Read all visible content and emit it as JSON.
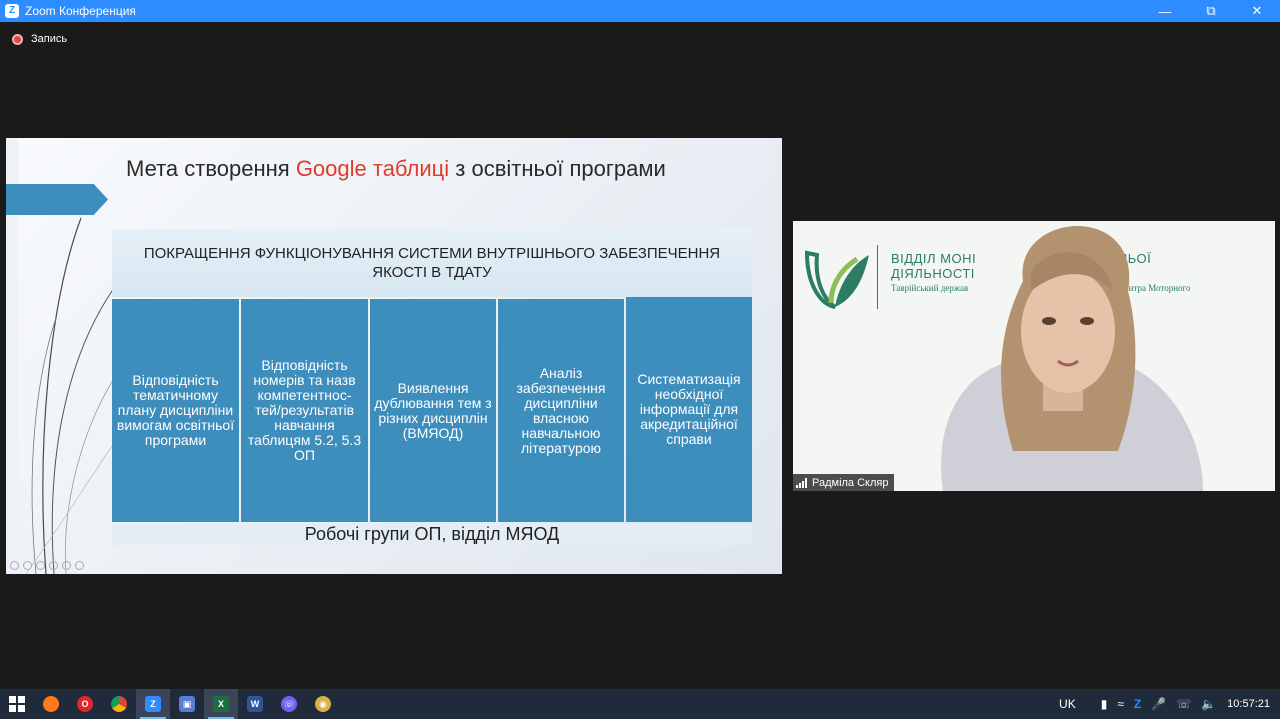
{
  "window": {
    "app_icon": "zoom-logo-icon",
    "title": "Zoom Конференция",
    "controls": [
      "minimize-icon",
      "restore-icon",
      "close-icon"
    ]
  },
  "recording": {
    "label": "Запись"
  },
  "slide": {
    "title_before": "Мета створення ",
    "title_accent": "Google таблиці",
    "title_after": " з освітньої програми",
    "header": "ПОКРАЩЕННЯ ФУНКЦІОНУВАННЯ СИСТЕМИ ВНУТРІШНЬОГО ЗАБЕЗПЕЧЕННЯ ЯКОСТІ В ТДАТУ",
    "columns": [
      "Відповідність тематичному плану дисципліни вимогам освітньої програми",
      "Відповідність номерів та назв компетентнос-тей/результатів навчання таблицям 5.2, 5.3 ОП",
      "Виявлення дублювання тем з різних дисциплін (ВМЯОД)",
      "Аналіз забезпечення дисципліни власною навчальною літературою",
      "Систематизація необхідної інформації для акредитаційної справи"
    ],
    "footer": "Робочі групи ОП, відділ МЯОД",
    "accent_color": "#e23a2c",
    "box_color": "#3d8dbd"
  },
  "video": {
    "logo_title_line1": "ВІДДІЛ МОНІ",
    "logo_title_line1b": "ВІТНЬОЇ",
    "logo_title_line2": "ДІЯЛЬНОСТІ",
    "logo_sub_a": "Таврійський держав",
    "logo_sub_b": "ені Дмитра Моторного",
    "participant_name": "Радміла Скляр"
  },
  "taskbar": {
    "apps": [
      {
        "name": "windows-start-icon",
        "color": "#ffffff"
      },
      {
        "name": "firefox-icon",
        "color": "#ff7a1a"
      },
      {
        "name": "opera-icon",
        "color": "#e0262d"
      },
      {
        "name": "chrome-icon",
        "color": "#4caf50"
      },
      {
        "name": "zoom-icon",
        "color": "#2d8cff"
      },
      {
        "name": "save-disk-icon",
        "color": "#5a7bd6"
      },
      {
        "name": "excel-icon",
        "color": "#1d6f42"
      },
      {
        "name": "word-icon",
        "color": "#2b579a"
      },
      {
        "name": "viber-icon",
        "color": "#7360f2"
      },
      {
        "name": "paint-icon",
        "color": "#d9b04c"
      }
    ],
    "tray": {
      "language": "UK",
      "clock": "10:57:21"
    }
  }
}
